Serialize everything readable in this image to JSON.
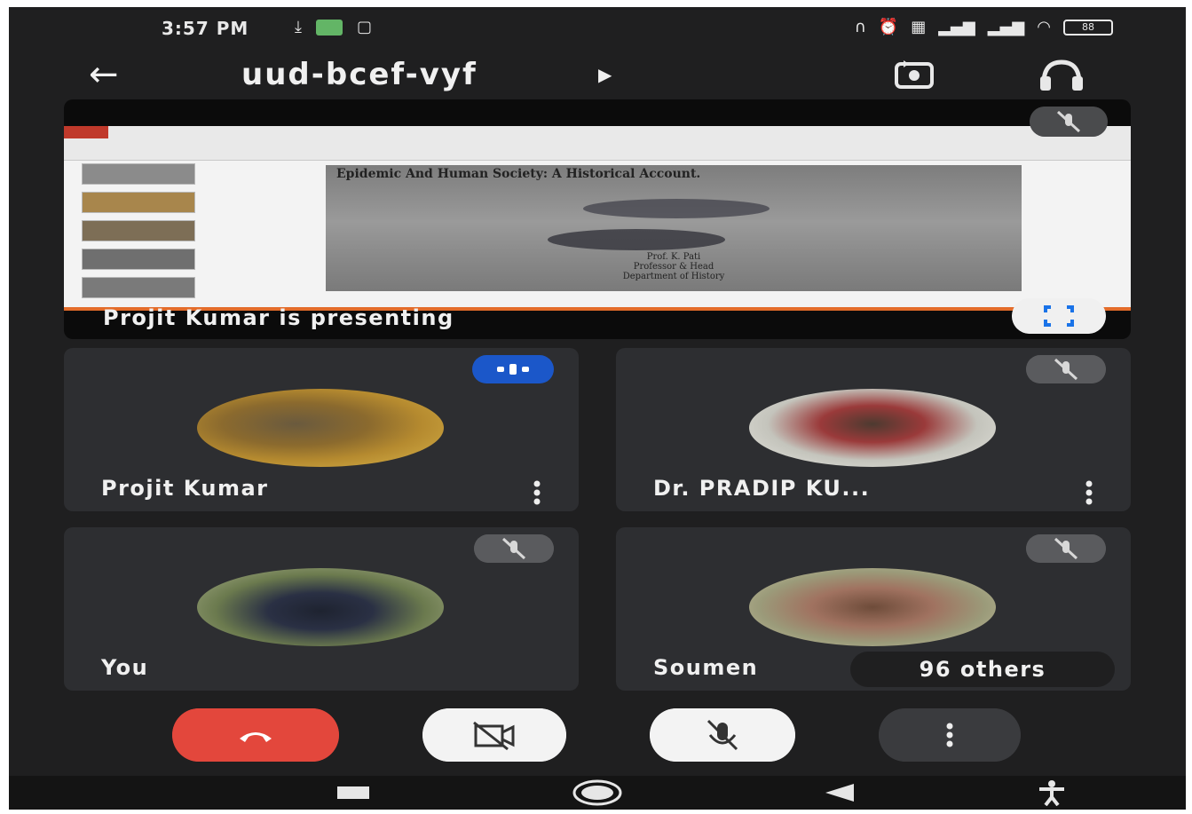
{
  "status_bar": {
    "time": "3:57 PM",
    "battery": "88"
  },
  "header": {
    "meeting_code": "uud-bcef-vyf"
  },
  "presentation": {
    "slide_title": "Epidemic And Human Society: A Historical Account.",
    "slide_subtitle_lines": [
      "Prof. K. Pati",
      "Professor & Head",
      "Department of History"
    ],
    "presenting_label": "Projit Kumar is presenting"
  },
  "participants": [
    {
      "name": "Projit Kumar",
      "state": "speaking"
    },
    {
      "name": "Dr. PRADIP KU...",
      "state": "muted"
    },
    {
      "name": "You",
      "state": "muted"
    },
    {
      "name": "Soumen",
      "state": "muted"
    }
  ],
  "others_label": "96 others",
  "colors": {
    "background": "#1f1f20",
    "tile": "#2d2e31",
    "end_call": "#e3473c",
    "speaking_badge": "#1b57c9",
    "presenting_bar": "#e36c2a"
  },
  "icons": {
    "back": "arrow-left-icon",
    "camera_switch": "camera-switch-icon",
    "audio": "headset-icon",
    "mic_off": "mic-off-icon",
    "cam_off": "camera-off-icon",
    "end_call": "phone-hangup-icon",
    "more": "more-vertical-icon",
    "fullscreen": "fullscreen-icon"
  }
}
